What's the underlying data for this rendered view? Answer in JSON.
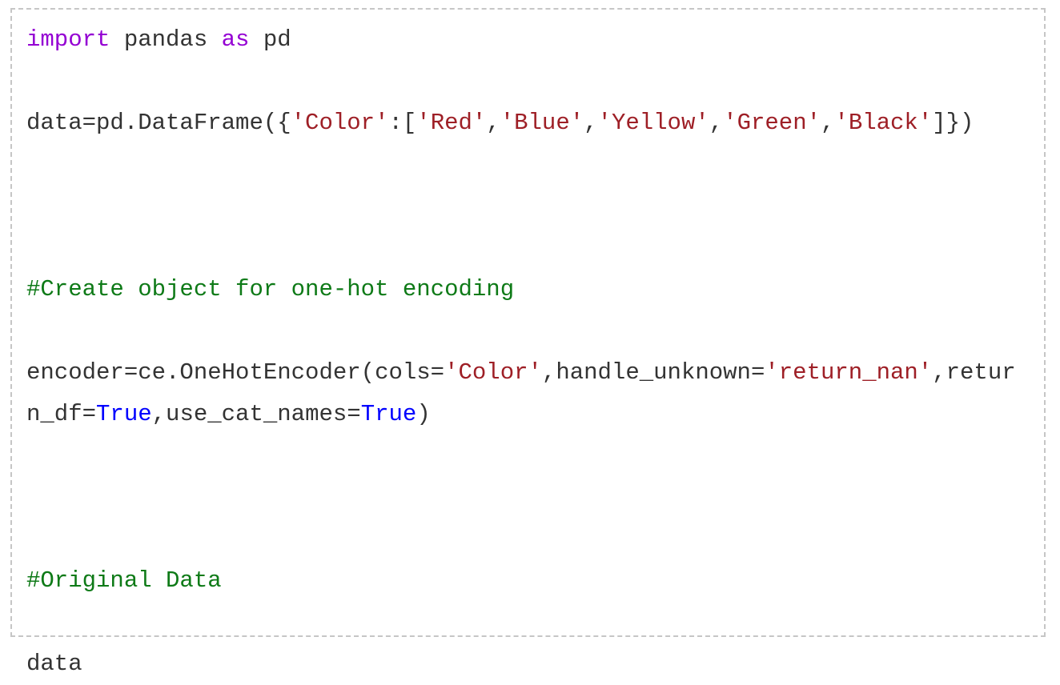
{
  "cell": {
    "name": "code-cell",
    "language": "python",
    "border_color": "#c6c6c6",
    "background_color": "#ffffff"
  },
  "syntax_colors": {
    "plain": "#333333",
    "keyword": "#9400d3",
    "string": "#9e1f26",
    "comment": "#0e7a17",
    "boolean": "#0000ff"
  },
  "lines": [
    {
      "id": "line-import",
      "tokens": [
        {
          "text": "import",
          "kind": "keyword"
        },
        {
          "text": " pandas ",
          "kind": "plain"
        },
        {
          "text": "as",
          "kind": "keyword"
        },
        {
          "text": " pd",
          "kind": "plain"
        }
      ]
    },
    {
      "id": "line-blank-1",
      "blank": true,
      "tokens": []
    },
    {
      "id": "line-dataframe",
      "tokens": [
        {
          "text": "data=pd.DataFrame({",
          "kind": "plain"
        },
        {
          "text": "'Color'",
          "kind": "string"
        },
        {
          "text": ":[",
          "kind": "plain"
        },
        {
          "text": "'Red'",
          "kind": "string"
        },
        {
          "text": ",",
          "kind": "plain"
        },
        {
          "text": "'Blue'",
          "kind": "string"
        },
        {
          "text": ",",
          "kind": "plain"
        },
        {
          "text": "'Yellow'",
          "kind": "string"
        },
        {
          "text": ",",
          "kind": "plain"
        },
        {
          "text": "'Green'",
          "kind": "string"
        },
        {
          "text": ",",
          "kind": "plain"
        },
        {
          "text": "'Black'",
          "kind": "string"
        },
        {
          "text": "]})",
          "kind": "plain"
        }
      ]
    },
    {
      "id": "line-blank-2",
      "blank": true,
      "tokens": []
    },
    {
      "id": "line-blank-3",
      "blank": true,
      "tokens": []
    },
    {
      "id": "line-blank-4",
      "blank": true,
      "tokens": []
    },
    {
      "id": "line-comment-create",
      "tokens": [
        {
          "text": "#Create object for one-hot encoding",
          "kind": "comment"
        }
      ]
    },
    {
      "id": "line-blank-5",
      "blank": true,
      "tokens": []
    },
    {
      "id": "line-encoder-a",
      "tokens": [
        {
          "text": "encoder=ce.OneHotEncoder(cols=",
          "kind": "plain"
        },
        {
          "text": "'Color'",
          "kind": "string"
        },
        {
          "text": ",handle_unknown=",
          "kind": "plain"
        },
        {
          "text": "'return_nan'",
          "kind": "string"
        },
        {
          "text": ",retur",
          "kind": "plain"
        }
      ]
    },
    {
      "id": "line-encoder-b",
      "tokens": [
        {
          "text": "n_df=",
          "kind": "plain"
        },
        {
          "text": "True",
          "kind": "boolean"
        },
        {
          "text": ",use_cat_names=",
          "kind": "plain"
        },
        {
          "text": "True",
          "kind": "boolean"
        },
        {
          "text": ")",
          "kind": "plain"
        }
      ]
    },
    {
      "id": "line-blank-6",
      "blank": true,
      "tokens": []
    },
    {
      "id": "line-blank-7",
      "blank": true,
      "tokens": []
    },
    {
      "id": "line-blank-8",
      "blank": true,
      "tokens": []
    },
    {
      "id": "line-comment-original",
      "tokens": [
        {
          "text": "#Original Data",
          "kind": "comment"
        }
      ]
    },
    {
      "id": "line-blank-9",
      "blank": true,
      "tokens": []
    },
    {
      "id": "line-data",
      "tokens": [
        {
          "text": "data",
          "kind": "plain"
        }
      ]
    }
  ]
}
